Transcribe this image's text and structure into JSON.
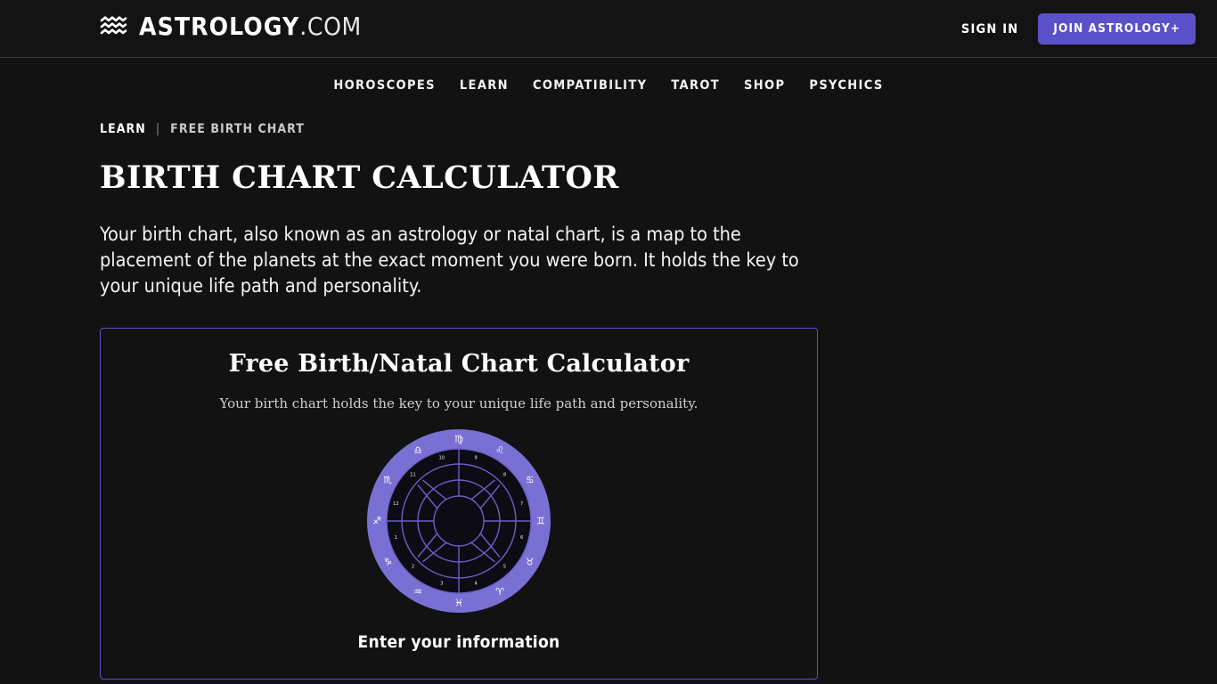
{
  "header": {
    "logo_icon": "aquarius-waves-icon",
    "brand_name": "ASTROLOGY",
    "brand_tld": ".COM",
    "sign_in_label": "SIGN IN",
    "join_label": "JOIN ASTROLOGY+",
    "accent_color": "#5b52c9",
    "background_color": "#131313"
  },
  "nav": {
    "items": [
      {
        "label": "HOROSCOPES"
      },
      {
        "label": "LEARN"
      },
      {
        "label": "COMPATIBILITY"
      },
      {
        "label": "TAROT"
      },
      {
        "label": "SHOP"
      },
      {
        "label": "PSYCHICS"
      }
    ]
  },
  "breadcrumb": {
    "parent": "LEARN",
    "separator": "|",
    "current": "FREE BIRTH CHART"
  },
  "page": {
    "title": "BIRTH CHART CALCULATOR",
    "intro": "Your birth chart, also known as an astrology or natal chart, is a map to the placement of the planets at the exact moment you were born. It holds the key to your unique life path and personality."
  },
  "calculator": {
    "title": "Free Birth/Natal Chart Calculator",
    "subtitle": "Your birth chart holds the key to your unique life path and personality.",
    "cta": "Enter your information",
    "border_color": "#5b52c9",
    "wheel": {
      "name": "natal-chart-wheel",
      "ring_color": "#7a70d4",
      "line_color": "#6a60c4",
      "inner_color": "#0d0b14",
      "zodiac_signs": [
        {
          "name": "virgo",
          "glyph": "♍"
        },
        {
          "name": "leo",
          "glyph": "♌"
        },
        {
          "name": "cancer",
          "glyph": "♋"
        },
        {
          "name": "gemini",
          "glyph": "♊"
        },
        {
          "name": "taurus",
          "glyph": "♉"
        },
        {
          "name": "aries",
          "glyph": "♈"
        },
        {
          "name": "pisces",
          "glyph": "♓"
        },
        {
          "name": "aquarius",
          "glyph": "♒"
        },
        {
          "name": "capricorn",
          "glyph": "♑"
        },
        {
          "name": "sagittarius",
          "glyph": "♐"
        },
        {
          "name": "scorpio",
          "glyph": "♏"
        },
        {
          "name": "libra",
          "glyph": "♎"
        }
      ],
      "house_numbers": [
        "9",
        "8",
        "7",
        "6",
        "5",
        "4",
        "3",
        "2",
        "1",
        "12",
        "11",
        "10"
      ]
    }
  }
}
